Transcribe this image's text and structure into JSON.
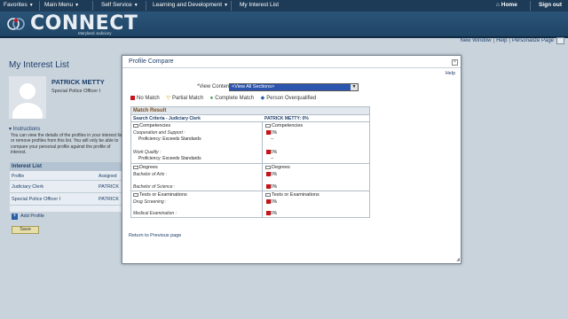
{
  "topnav": {
    "favorites": "Favorites",
    "main_menu": "Main Menu",
    "self_service": "Self Service",
    "learning": "Learning and Development",
    "my_interest_list": "My Interest List",
    "home": "Home",
    "sign_out": "Sign out"
  },
  "banner": {
    "logo_text": "CONNECT",
    "logo_sub": "Maryland Judiciary"
  },
  "utility": {
    "new_window": "New Window",
    "help": "Help",
    "personalize": "Personalize Page"
  },
  "page": {
    "title": "My Interest List",
    "profile_name": "PATRICK METTY",
    "profile_role": "Special Police Officer I",
    "instructions_title": "Instructions",
    "instructions_text": "You can view the details of the profiles in your interest list or remove profiles from this list. You will only be able to compare your personal profile against the profile of interest.",
    "interest_list": {
      "header": "Interest List",
      "columns": [
        "Profile",
        "Assigned"
      ],
      "rows": [
        {
          "profile": "Judiciary Clerk",
          "assigned": "PATRICK"
        },
        {
          "profile": "Special Police Officer I",
          "assigned": "PATRICK"
        }
      ]
    },
    "add_profile": "Add Profile",
    "save": "Save"
  },
  "modal": {
    "title": "Profile Compare",
    "help": "Help",
    "view_label": "*View Content Section",
    "view_value": "<View All Sections>",
    "legend": [
      {
        "symbol": "square",
        "color": "#c4151c",
        "label": "No Match"
      },
      {
        "symbol": "▽",
        "color": "#d1a000",
        "label": "Partial Match"
      },
      {
        "symbol": "●",
        "color": "#2e8b2e",
        "label": "Complete Match"
      },
      {
        "symbol": "◆",
        "color": "#2a5fa8",
        "label": "Person Overqualified"
      }
    ],
    "match": {
      "header": "Match Result",
      "criteria_left": "Search Criteria - Judiciary Clerk",
      "criteria_right": "PATRICK METTY: 0%",
      "competencies": {
        "left_title": "Competencies",
        "right_title": "Competencies",
        "item1": "Cooperation and Support :",
        "item1_prof": "Proficiency: Exceeds Standards",
        "item2": "Work Quality :",
        "item2_prof": "Proficiency: Exceeds Standards",
        "pct1": "0%",
        "pct2": "0%",
        "dash": "--"
      },
      "degrees": {
        "left_title": "Degrees",
        "right_title": "Degrees",
        "item1": "Bachelor of Arts :",
        "item2": "Bachelor of Science :",
        "pct1": "0%",
        "pct2": "0%"
      },
      "tests": {
        "left_title": "Tests or Examinations",
        "right_title": "Tests or Examinations",
        "item1": "Drug Screening :",
        "item2": "Medical Examination :",
        "pct1": "0%",
        "pct2": "0%"
      }
    },
    "return_link": "Return to Previous page"
  }
}
